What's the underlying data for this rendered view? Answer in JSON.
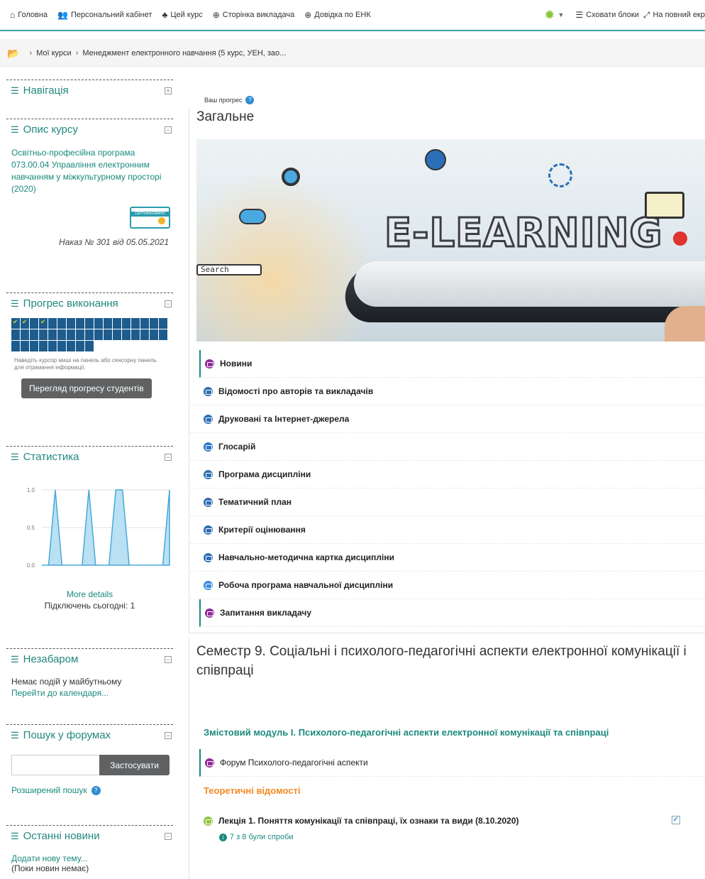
{
  "topbar": {
    "items": [
      {
        "icon": "home-icon",
        "label": "Головна"
      },
      {
        "icon": "users-icon",
        "label": "Персональний кабінет"
      },
      {
        "icon": "sitemap-icon",
        "label": "Цей курс"
      },
      {
        "icon": "lifebuoy-icon",
        "label": "Сторінка викладача"
      },
      {
        "icon": "lifebuoy-icon",
        "label": "Довідка по ЕНК"
      }
    ],
    "hide_blocks": "Сховати блоки",
    "fullscreen": "На повний екр"
  },
  "breadcrumb": {
    "items": [
      "Мої курси",
      "Менеджмент електронного навчання (5 курс, УЕН, зао..."
    ]
  },
  "blocks": {
    "navigation": {
      "title": "Навігація"
    },
    "course_desc": {
      "title": "Опис курсу",
      "program": "Освітньо-професійна програма 073.00.04 Управління електронним навчанням у міжкультурному просторі (2020)",
      "badge": "СЕРТИФІКОВАНО",
      "order": "Наказ № 301 від 05.05.2021"
    },
    "progress": {
      "title": "Прогрес виконання",
      "hint": "Наведіть курсор миші на панель або сенсорну панель для отримання інформації.",
      "button": "Перегляд прогресу студентів"
    },
    "stats": {
      "title": "Статистика",
      "more": "More details",
      "today": "Підключень сьогодні: 1"
    },
    "upcoming": {
      "title": "Незабаром",
      "none": "Немає подій у майбутньому",
      "calendar": "Перейти до календаря..."
    },
    "forum_search": {
      "title": "Пошук у форумах",
      "apply": "Застосувати",
      "advanced": "Розширений пошук"
    },
    "news": {
      "title": "Останні новини",
      "add": "Додати нову тему...",
      "empty": "(Поки новин немає)"
    }
  },
  "chart_data": {
    "type": "area",
    "yticks": [
      "1.0",
      "0.5",
      "0.0"
    ],
    "ylim": [
      0,
      1
    ],
    "values": [
      0,
      0,
      1,
      0,
      0,
      0,
      0,
      1,
      0,
      0,
      0,
      1,
      1,
      0,
      0,
      0,
      0,
      0,
      0,
      1
    ]
  },
  "main": {
    "progress_label": "Ваш прогрес",
    "general_title": "Загальне",
    "banner_text": "E-LEARNING",
    "banner_search": "Search",
    "general_items": [
      {
        "label": "Новини",
        "icon": "forum-icon",
        "marked": true
      },
      {
        "label": "Відомості про авторів та викладачів",
        "icon": "page-icon",
        "marked": false
      },
      {
        "label": "Друковані та Інтернет-джерела",
        "icon": "page-icon",
        "marked": false
      },
      {
        "label": "Глосарій",
        "icon": "glossary-icon",
        "marked": false
      },
      {
        "label": "Програма дисципліни",
        "icon": "page-icon",
        "marked": false
      },
      {
        "label": "Тематичний план",
        "icon": "page-icon",
        "marked": false
      },
      {
        "label": "Критерії оцінювання",
        "icon": "page-icon",
        "marked": false
      },
      {
        "label": "Навчально-методична картка дисципліни",
        "icon": "page-icon",
        "marked": false
      },
      {
        "label": "Робоча програма навчальної дисципліни",
        "icon": "url-icon",
        "marked": false
      },
      {
        "label": "Запитання викладачу",
        "icon": "forum-icon",
        "marked": true
      }
    ],
    "semester_title": "Семестр 9. Соціальні і психолого-педагогічні аспекти електронної комунікації і співпраці",
    "module_title": "Змістовий модуль І. Психолого-педагогічні аспекти електронної комунікації та співпраці",
    "forum_item": "Форум Психолого-педагогічні аспекти",
    "theory_title": "Теоретичні відомості",
    "lecture": "Лекція 1. Поняття комунікації та співпраці, їх ознаки та види (8.10.2020)",
    "attempts": "7 з 8 були спроби"
  }
}
